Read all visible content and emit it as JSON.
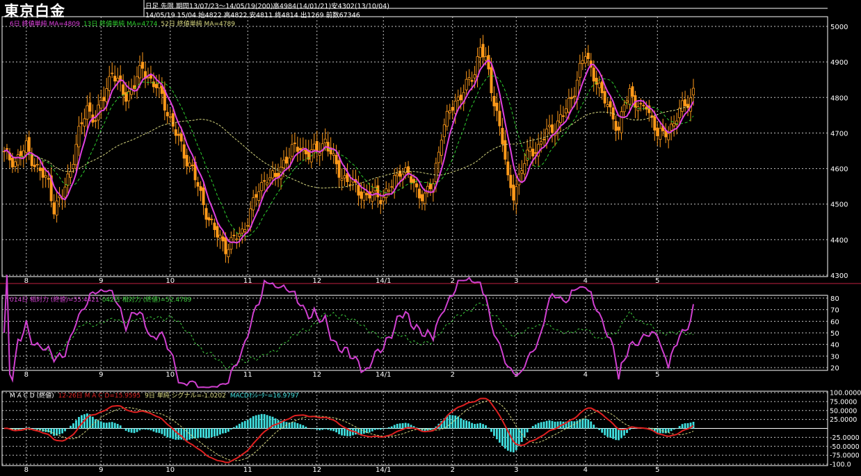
{
  "header": {
    "title": "東京白金",
    "info_line1": "日足 先限  期間13/07/23～14/05/19(200)高4984(14/01/21)安4302(13/10/04)",
    "info_line2": "14/05/19 15/04 始4822 高4822 安4811 終4814 出1269 前数67346"
  },
  "colors": {
    "background": "#000000",
    "grid": "#c8c8c8",
    "candle": "#ff9a1a",
    "ma_fast": "#e040e0",
    "ma_mid": "#2ed02e",
    "ma_slow": "#d8d880",
    "rsi_fast": "#d040d0",
    "rsi_slow": "#40d040",
    "macd": "#e02020",
    "signal": "#d8d880",
    "histogram": "#40e0e0",
    "border": "#c02040"
  },
  "legends": {
    "price": [
      {
        "text": "6日 終値単純 MA=4809",
        "color": "#e040e0"
      },
      {
        "text": "13日 終値単純 MA=4774",
        "color": "#2ed02e"
      },
      {
        "text": "52日 終値単純 MA=4789",
        "color": "#d8d880"
      }
    ],
    "rsi": [
      {
        "text": "014日 相対力 (終値)=55.4421",
        "color": "#d040d0"
      },
      {
        "text": "042日 相対力 (終値)=52.4789",
        "color": "#40d040"
      }
    ],
    "macd": [
      {
        "text": "M A C D (終値)",
        "color": "#ffffff"
      },
      {
        "text": "12-26日 M A C D=15.9595",
        "color": "#e02020"
      },
      {
        "text": "9日 単純 シグナル=-1.0202",
        "color": "#d8d880"
      },
      {
        "text": "MACDｵｼﾚｰﾀｰ=16.9797",
        "color": "#40e0e0"
      }
    ]
  },
  "chart_data": [
    {
      "type": "candlestick",
      "name_key": "price",
      "ylim": [
        4300,
        5000
      ],
      "yticks": [
        4300,
        4400,
        4500,
        4600,
        4700,
        4800,
        4900,
        5000
      ],
      "x_months": [
        "8",
        "9",
        "10",
        "11",
        "12",
        "14/1",
        "2",
        "3",
        "4",
        "5"
      ],
      "grid": true,
      "close_path": [
        [
          0,
          4640
        ],
        [
          4,
          4620
        ],
        [
          8,
          4660
        ],
        [
          12,
          4600
        ],
        [
          16,
          4560
        ],
        [
          18,
          4490
        ],
        [
          21,
          4520
        ],
        [
          24,
          4600
        ],
        [
          27,
          4700
        ],
        [
          30,
          4770
        ],
        [
          33,
          4740
        ],
        [
          36,
          4800
        ],
        [
          39,
          4880
        ],
        [
          41,
          4840
        ],
        [
          44,
          4800
        ],
        [
          47,
          4840
        ],
        [
          50,
          4880
        ],
        [
          53,
          4850
        ],
        [
          56,
          4820
        ],
        [
          59,
          4760
        ],
        [
          62,
          4700
        ],
        [
          65,
          4640
        ],
        [
          68,
          4600
        ],
        [
          71,
          4520
        ],
        [
          74,
          4460
        ],
        [
          77,
          4410
        ],
        [
          80,
          4380
        ],
        [
          83,
          4400
        ],
        [
          86,
          4420
        ],
        [
          89,
          4480
        ],
        [
          92,
          4540
        ],
        [
          95,
          4580
        ],
        [
          98,
          4570
        ],
        [
          101,
          4620
        ],
        [
          104,
          4650
        ],
        [
          107,
          4660
        ],
        [
          110,
          4640
        ],
        [
          113,
          4650
        ],
        [
          116,
          4680
        ],
        [
          119,
          4620
        ],
        [
          122,
          4580
        ],
        [
          125,
          4560
        ],
        [
          128,
          4540
        ],
        [
          131,
          4520
        ],
        [
          134,
          4530
        ],
        [
          137,
          4520
        ],
        [
          140,
          4550
        ],
        [
          143,
          4600
        ],
        [
          146,
          4580
        ],
        [
          149,
          4540
        ],
        [
          152,
          4520
        ],
        [
          155,
          4560
        ],
        [
          158,
          4700
        ],
        [
          161,
          4760
        ],
        [
          164,
          4800
        ],
        [
          167,
          4830
        ],
        [
          170,
          4870
        ],
        [
          172,
          4950
        ],
        [
          174,
          4900
        ],
        [
          176,
          4820
        ],
        [
          178,
          4760
        ],
        [
          180,
          4680
        ],
        [
          182,
          4560
        ],
        [
          184,
          4530
        ],
        [
          187,
          4600
        ],
        [
          190,
          4650
        ],
        [
          193,
          4660
        ],
        [
          196,
          4700
        ],
        [
          199,
          4720
        ],
        [
          202,
          4750
        ],
        [
          205,
          4800
        ],
        [
          208,
          4880
        ],
        [
          210,
          4920
        ],
        [
          212,
          4880
        ],
        [
          214,
          4850
        ],
        [
          216,
          4800
        ],
        [
          218,
          4780
        ],
        [
          220,
          4750
        ],
        [
          222,
          4700
        ],
        [
          224,
          4780
        ],
        [
          226,
          4820
        ],
        [
          228,
          4790
        ],
        [
          230,
          4760
        ],
        [
          232,
          4780
        ],
        [
          234,
          4740
        ],
        [
          236,
          4700
        ],
        [
          238,
          4690
        ],
        [
          240,
          4710
        ],
        [
          242,
          4730
        ],
        [
          244,
          4760
        ],
        [
          246,
          4780
        ],
        [
          248,
          4800
        ],
        [
          250,
          4840
        ]
      ],
      "series": [
        {
          "name": "6日 終値単純 MA",
          "values_key": "ma6"
        },
        {
          "name": "13日 終値単純 MA",
          "values_key": "ma13"
        },
        {
          "name": "52日 終値単純 MA",
          "values_key": "ma52"
        }
      ]
    },
    {
      "type": "line",
      "name_key": "rsi",
      "ylim": [
        20,
        80
      ],
      "yticks": [
        20,
        30,
        40,
        50,
        60,
        70,
        80
      ]
    },
    {
      "type": "bar",
      "name_key": "macd",
      "ylim": [
        -100,
        100
      ],
      "yticks": [
        -100,
        -75,
        -50,
        -25,
        0,
        25,
        50,
        75,
        100
      ],
      "ytick_labels": [
        "-100.0",
        "-75.0000",
        "-50.0000",
        "-25.0000",
        "",
        "25.0000",
        "50.0000",
        "75.0000",
        "100.0000"
      ]
    }
  ]
}
